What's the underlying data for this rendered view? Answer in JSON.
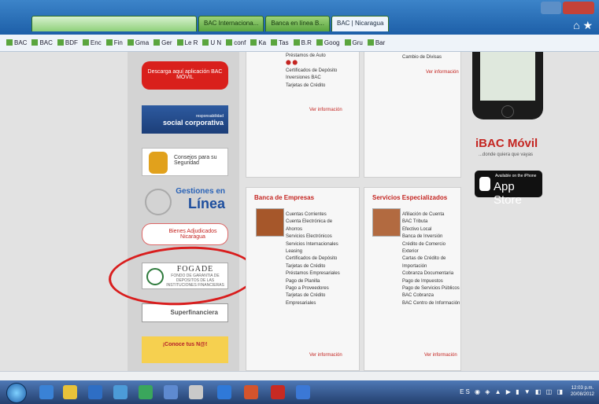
{
  "browser": {
    "tabs": [
      "BAC Internaciona...",
      "Banca en línea B...",
      "BAC | Nicaragua"
    ],
    "favorites": [
      "BAC",
      "BAC",
      "BDF",
      "Enc",
      "Fin",
      "Gma",
      "Ger",
      "Le R",
      "U N",
      "conf",
      "Ka",
      "Tas",
      "B.R",
      "Goog",
      "Gru",
      "Bar"
    ]
  },
  "sidebar": {
    "bac_movil": "Descarga aquí aplicación BAC MÓVIL",
    "social_small": "responsabilidad",
    "social": "social corporativa",
    "seguridad": "Consejos para su Seguridad",
    "gestiones": "Gestiones en",
    "linea": "Línea",
    "bienes": "Bienes Adjudicados Nicaragua",
    "fogade": "FOGADE",
    "fogade_sub": "FONDO DE GARANTIA DE DEPOSITOS DE LAS INSTITUCIONES FINANCIERAS",
    "superfinanciero": "Superfinanciera",
    "conoce": "¡Conoce tus N@!"
  },
  "panels": {
    "top_left_links": [
      "Préstamos de Auto",
      "Certificados de Depósito",
      "Inversiones BAC",
      "Tarjetas de Crédito"
    ],
    "top_right_links": [
      "Cambio de Divisas"
    ],
    "more": "Ver información",
    "empresas": {
      "title": "Banca de Empresas",
      "links": [
        "Cuentas Corrientes",
        "Cuenta Electrónica de",
        "Ahorros",
        "Servicios Electrónicos",
        "Servicios Internacionales",
        "Leasing",
        "Certificados de Depósito",
        "Tarjetas de Crédito",
        "Préstamos Empresariales",
        "Pago de Planilla",
        "Pago a Proveedores",
        "Tarjetas de Crédito",
        "Empresariales"
      ]
    },
    "especializados": {
      "title": "Servicios Especializados",
      "links": [
        "Afiliación de Cuenta",
        "BAC Tributa",
        "Efectivo Local",
        "Banca de Inversión",
        "Crédito de Comercio",
        "Exterior",
        "Cartas de Crédito de",
        "Importación",
        "Cobranza Documentaria",
        "Pago de Impuestos",
        "Pago de Servicios Públicos",
        "BAC Cobranza",
        "BAC Centro de Información"
      ]
    }
  },
  "right_column": {
    "ibac": "iBAC Móvil",
    "ibac_sub": "...donde quiera que vayas",
    "appstore_small": "Available on the iPhone",
    "appstore": "App Store"
  },
  "taskbar": {
    "clock_time": "12:03 p.m.",
    "clock_date": "20/08/2012",
    "icons_colors": [
      "#3a82d6",
      "#e8c23a",
      "#2e6ec4",
      "#4c9bd8",
      "#3aa65c",
      "#5e8ad0",
      "#c9c9c9",
      "#2f79d8",
      "#d4542c",
      "#c82a22",
      "#3b78d6"
    ]
  }
}
